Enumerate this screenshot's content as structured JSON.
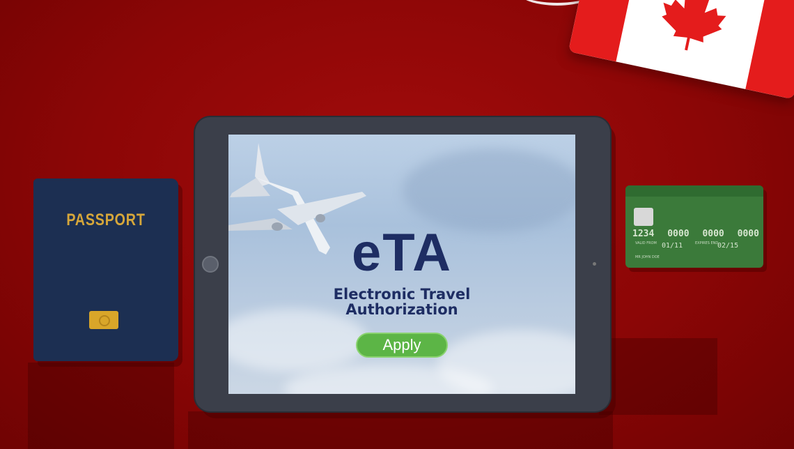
{
  "passport": {
    "label": "PASSPORT",
    "colors": {
      "cover": "#1c2f52",
      "text": "#d6a73a"
    }
  },
  "tablet": {
    "title": "eTA",
    "subtitle_line1": "Electronic Travel",
    "subtitle_line2": "Authorization",
    "apply_label": "Apply",
    "colors": {
      "title": "#1e2d63",
      "button": "#5cb546"
    }
  },
  "card": {
    "number_groups": [
      "1234",
      "0000",
      "0000",
      "0000"
    ],
    "valid_from_label": "VALID FROM",
    "valid_from": "01/11",
    "expires_label": "EXPIRES END",
    "expires": "02/15",
    "holder": "MR JOHN DOE",
    "colors": {
      "body": "#3b7a3a"
    }
  },
  "background": {
    "color": "#9a0a0a"
  },
  "icons": [
    "airplane-icon",
    "maple-leaf-icon",
    "chip-icon"
  ]
}
